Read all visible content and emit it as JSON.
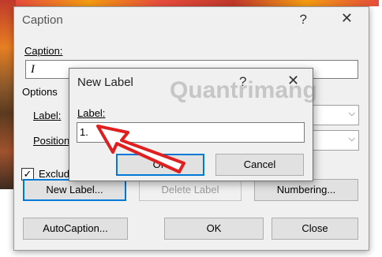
{
  "caption_dialog": {
    "title": "Caption",
    "help": "?",
    "close": "✕",
    "caption_label": "Caption:",
    "caption_value": "I",
    "options_label": "Options",
    "label_label": "Label:",
    "position_label": "Position",
    "exclude_label": "Exclude",
    "exclude_checked": "✓",
    "buttons": {
      "new_label": "New Label...",
      "delete_label": "Delete Label",
      "numbering": "Numbering...",
      "autocaption": "AutoCaption...",
      "ok": "OK",
      "close": "Close"
    }
  },
  "new_label_dialog": {
    "title": "New Label",
    "help": "?",
    "close": "✕",
    "label_label": "Label:",
    "label_value": "1.",
    "ok": "OK",
    "cancel": "Cancel"
  },
  "watermark_text": "Quantrimang",
  "accent_color": "#0078d7",
  "annotation_arrow_color": "#e02020"
}
